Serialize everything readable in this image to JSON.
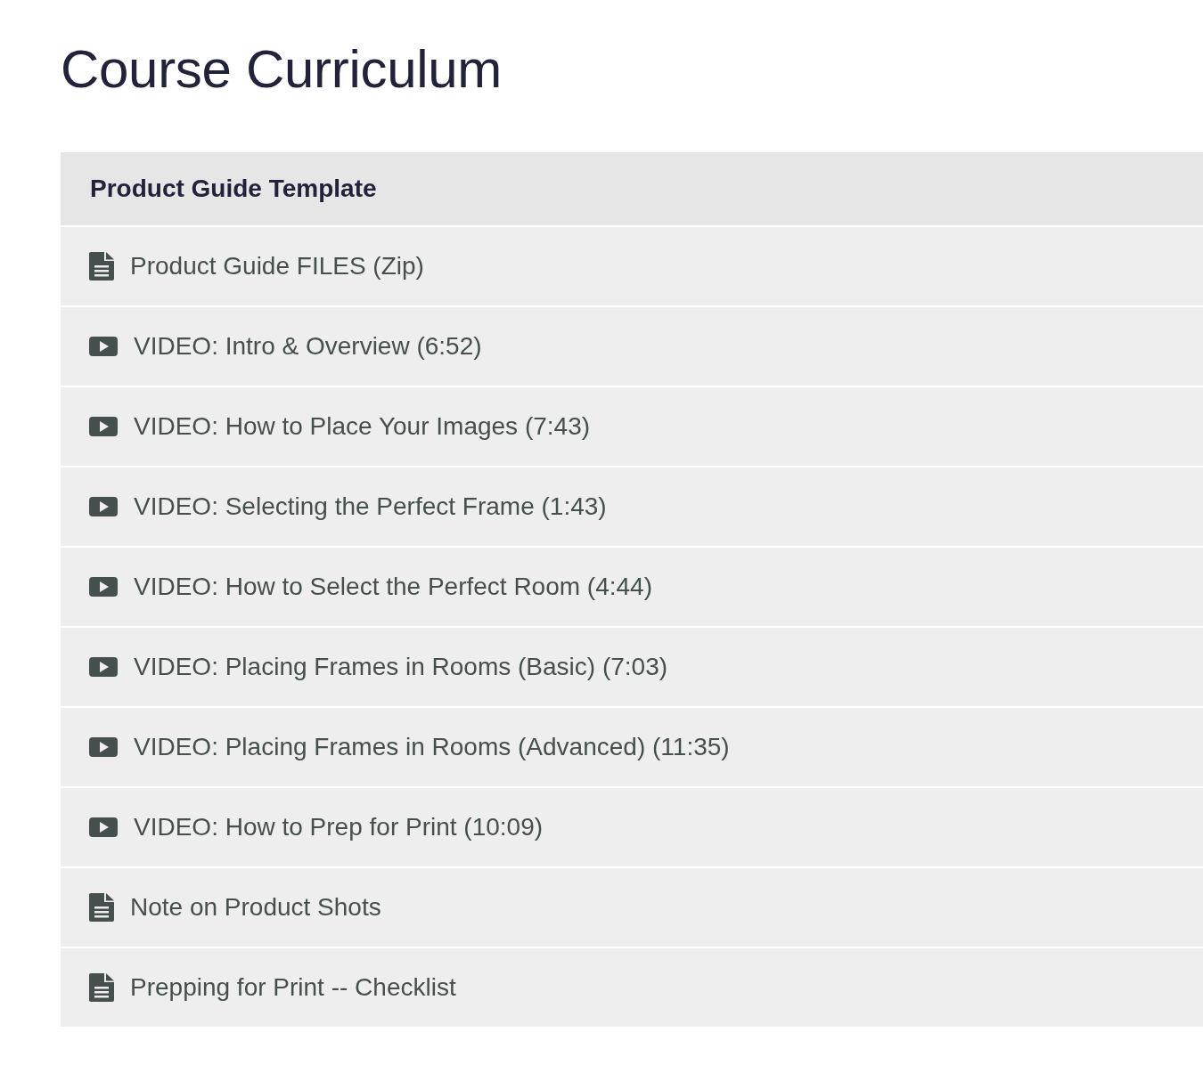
{
  "title": "Course Curriculum",
  "section": {
    "title": "Product Guide Template",
    "items": [
      {
        "kind": "file",
        "label": "Product Guide FILES (Zip)"
      },
      {
        "kind": "video",
        "label": "VIDEO: Intro & Overview (6:52)"
      },
      {
        "kind": "video",
        "label": "VIDEO: How to Place Your Images (7:43)"
      },
      {
        "kind": "video",
        "label": "VIDEO: Selecting the Perfect Frame (1:43)"
      },
      {
        "kind": "video",
        "label": "VIDEO: How to Select the Perfect Room (4:44)"
      },
      {
        "kind": "video",
        "label": "VIDEO: Placing Frames in Rooms (Basic) (7:03)"
      },
      {
        "kind": "video",
        "label": "VIDEO: Placing Frames in Rooms (Advanced) (11:35)"
      },
      {
        "kind": "video",
        "label": "VIDEO: How to Prep for Print (10:09)"
      },
      {
        "kind": "file",
        "label": "Note on Product Shots"
      },
      {
        "kind": "file",
        "label": "Prepping for Print -- Checklist"
      }
    ]
  }
}
